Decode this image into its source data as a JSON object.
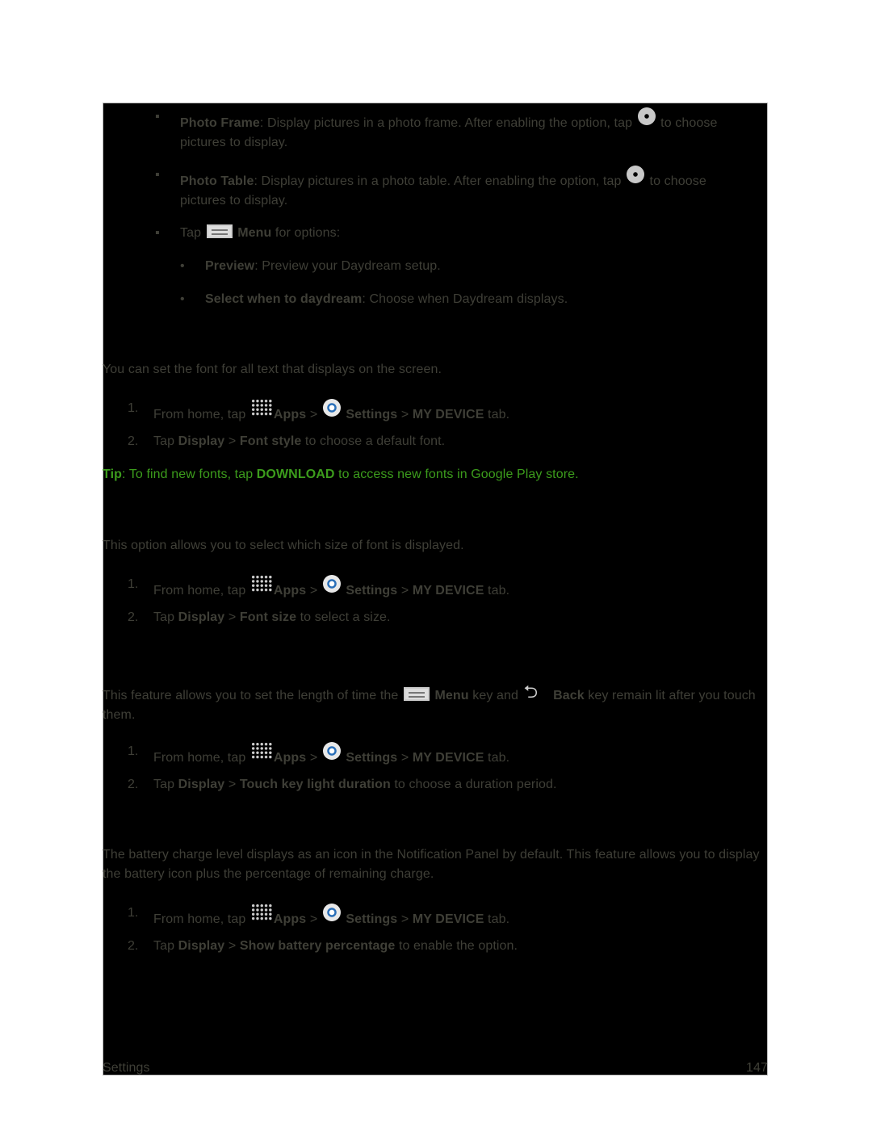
{
  "lines": [
    [
      {
        "b": "Photo Frame"
      },
      {
        "t": ": Display pictures in a photo frame. After enabling the option, tap "
      },
      {
        "icon": "gear-icon"
      },
      {
        "t": " to choose pictures to display."
      }
    ],
    [
      {
        "b": "Photo Table"
      },
      {
        "t": ": Display pictures in a photo table. After enabling the option, tap "
      },
      {
        "icon": "gear-icon"
      },
      {
        "t": " to choose pictures to display."
      }
    ],
    [
      {
        "t": "Tap "
      },
      {
        "icon": "menu-icon"
      },
      {
        "t": " "
      },
      {
        "b": "Menu"
      },
      {
        "t": " for options:"
      }
    ],
    [
      {
        "b": "Preview"
      },
      {
        "t": ": Preview your Daydream setup."
      }
    ],
    [
      {
        "b": "Select when to daydream"
      },
      {
        "t": ": Choose when Daydream displays."
      }
    ],
    [
      {
        "t": "You can set the font for all text that displays on the screen."
      }
    ],
    [
      {
        "t": "From home, tap "
      },
      {
        "icon": "apps-icon"
      },
      {
        "b": "Apps"
      },
      {
        "t": " > "
      },
      {
        "icon": "settings-icon"
      },
      {
        "t": " "
      },
      {
        "b": "Settings"
      },
      {
        "t": " > "
      },
      {
        "b": "MY DEVICE"
      },
      {
        "t": " tab."
      }
    ],
    [
      {
        "t": "Tap "
      },
      {
        "b": "Display"
      },
      {
        "t": " > "
      },
      {
        "b": "Font style"
      },
      {
        "t": " to choose a default font."
      }
    ],
    [
      {
        "b": "Tip"
      },
      {
        "t": ": To find new fonts, tap "
      },
      {
        "b": "DOWNLOAD"
      },
      {
        "t": " to access new fonts in Google Play store."
      }
    ],
    [
      {
        "t": "This option allows you to select which size of font is displayed."
      }
    ],
    [
      {
        "t": "From home, tap "
      },
      {
        "icon": "apps-icon"
      },
      {
        "b": "Apps"
      },
      {
        "t": " > "
      },
      {
        "icon": "settings-icon"
      },
      {
        "t": " "
      },
      {
        "b": "Settings"
      },
      {
        "t": " > "
      },
      {
        "b": "MY DEVICE"
      },
      {
        "t": " tab."
      }
    ],
    [
      {
        "t": "Tap "
      },
      {
        "b": "Display"
      },
      {
        "t": " > "
      },
      {
        "b": "Font size"
      },
      {
        "t": " to select a size."
      }
    ],
    [
      {
        "t": "This feature allows you to set the length of time the "
      },
      {
        "icon": "menu-icon"
      },
      {
        "t": " "
      },
      {
        "b": "Menu"
      },
      {
        "t": " key and "
      },
      {
        "icon": "back-icon"
      },
      {
        "t": " "
      },
      {
        "b": "Back"
      },
      {
        "t": " key remain lit after you touch them."
      }
    ],
    [
      {
        "t": "From home, tap "
      },
      {
        "icon": "apps-icon"
      },
      {
        "b": "Apps"
      },
      {
        "t": " > "
      },
      {
        "icon": "settings-icon"
      },
      {
        "t": " "
      },
      {
        "b": "Settings"
      },
      {
        "t": " > "
      },
      {
        "b": "MY DEVICE"
      },
      {
        "t": " tab."
      }
    ],
    [
      {
        "t": "Tap "
      },
      {
        "b": "Display"
      },
      {
        "t": " > "
      },
      {
        "b": "Touch key light duration"
      },
      {
        "t": " to choose a duration period."
      }
    ],
    [
      {
        "t": "The battery charge level displays as an icon in the Notification Panel by default. This feature allows you to display the battery icon plus the percentage of remaining charge."
      }
    ],
    [
      {
        "t": "From home, tap "
      },
      {
        "icon": "apps-icon"
      },
      {
        "b": "Apps"
      },
      {
        "t": " > "
      },
      {
        "icon": "settings-icon"
      },
      {
        "t": " "
      },
      {
        "b": "Settings"
      },
      {
        "t": " > "
      },
      {
        "b": "MY DEVICE"
      },
      {
        "t": " tab."
      }
    ],
    [
      {
        "t": "Tap "
      },
      {
        "b": "Display"
      },
      {
        "t": " > "
      },
      {
        "b": "Show battery percentage"
      },
      {
        "t": " to enable the option."
      }
    ]
  ],
  "markers": {
    "square": "▪",
    "dot": "•",
    "n1": "1.",
    "n2": "2."
  },
  "footer": {
    "section": "Settings",
    "page": "147"
  },
  "colors": {
    "text": "#3f3f37",
    "tip": "#3c9c1c",
    "background": "#000000"
  }
}
